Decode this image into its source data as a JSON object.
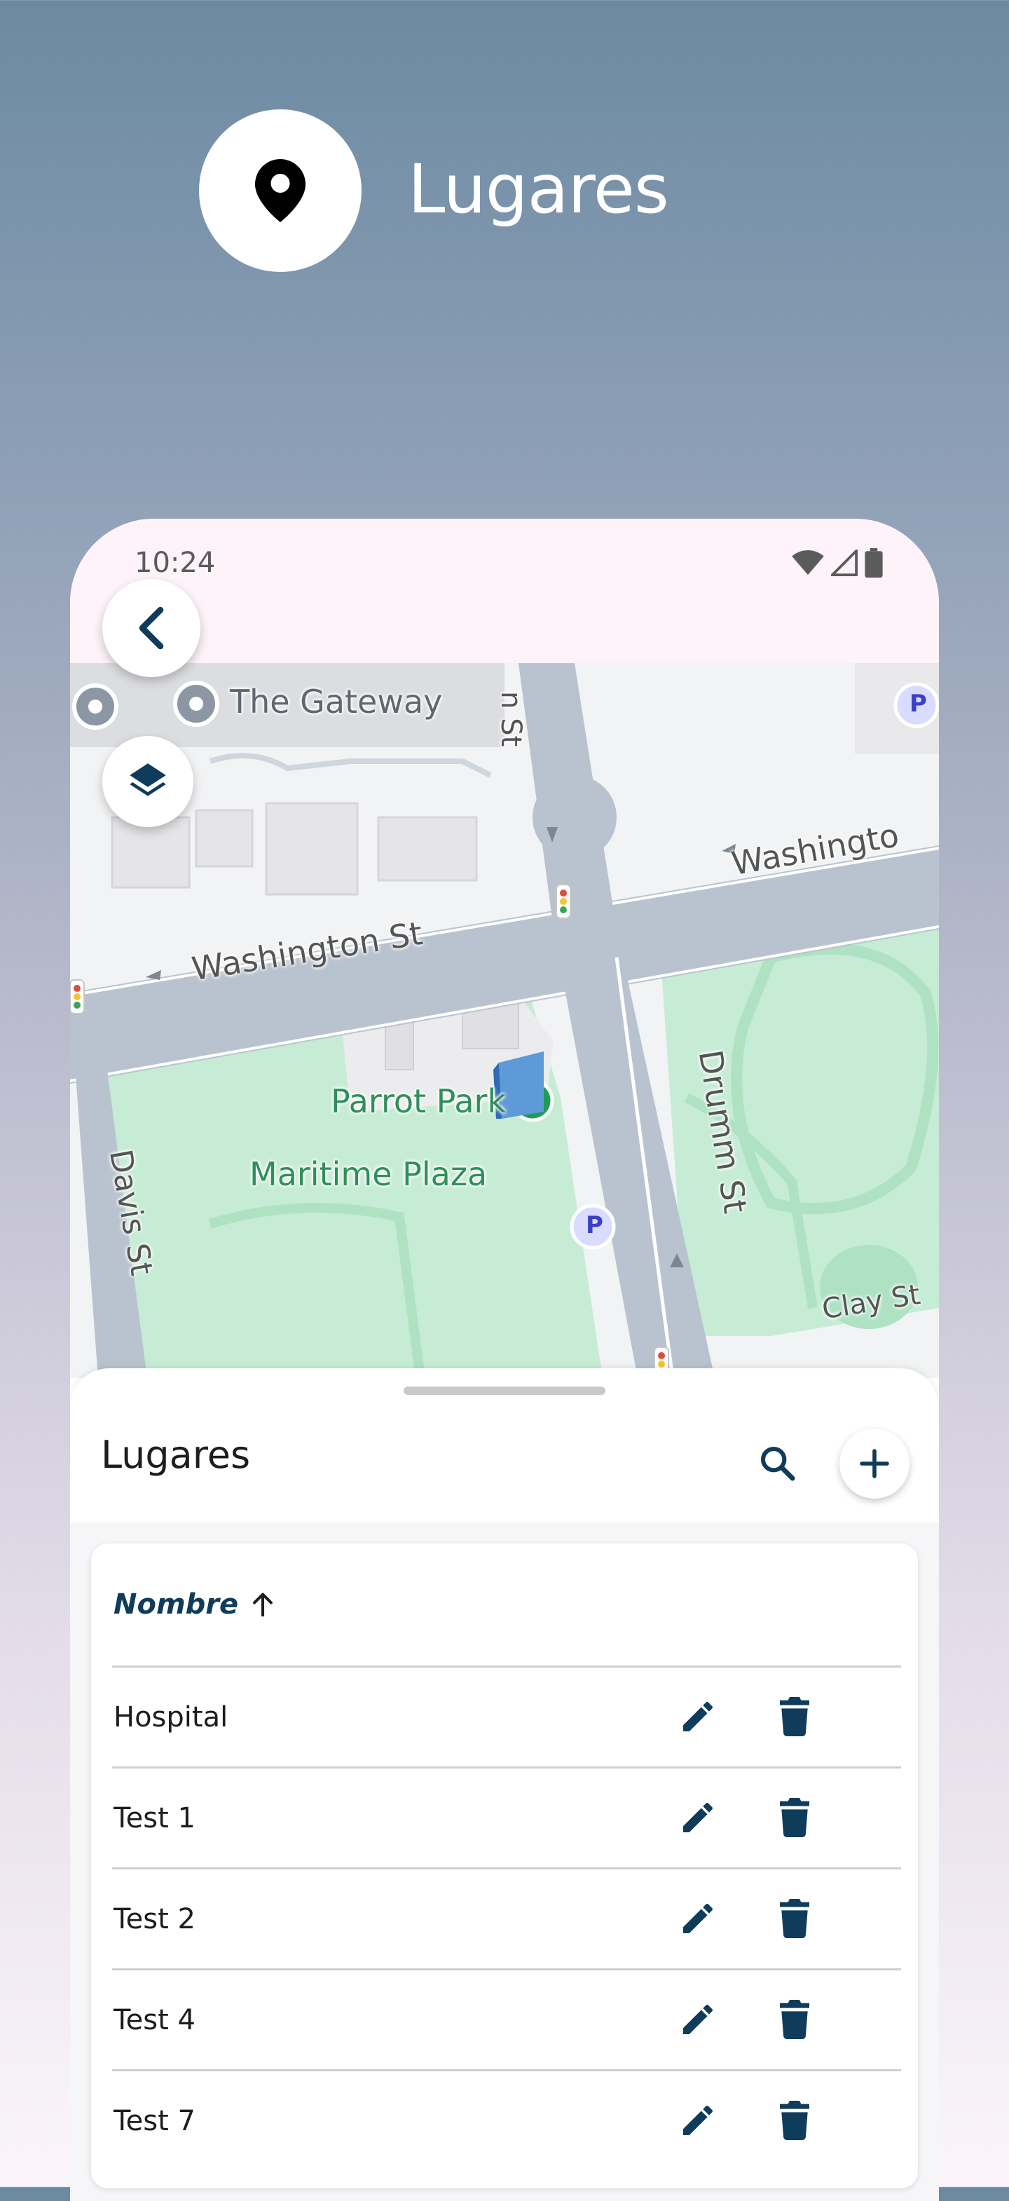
{
  "promo": {
    "title": "Lugares",
    "icon": "location-pin-icon"
  },
  "status_bar": {
    "time": "10:24",
    "icons": [
      "wifi-icon",
      "cell-signal-icon",
      "battery-icon"
    ]
  },
  "map": {
    "labels": {
      "gateway": "The Gateway",
      "washington_left": "Washington St",
      "washington_right": "Washingto",
      "drumm": "Drumm St",
      "davis": "Davis St",
      "clay": "Clay St",
      "parrot_park": "Parrot Park",
      "maritime_plaza": "Maritime Plaza",
      "top_street": "n St",
      "parking": "P"
    },
    "controls": {
      "back": "back-arrow-icon",
      "layers": "layers-icon"
    }
  },
  "sheet": {
    "title": "Lugares",
    "search_icon": "search-icon",
    "add_icon": "add-icon",
    "table": {
      "column": "Nombre",
      "sort_icon": "arrow-up-icon",
      "rows": [
        {
          "name": "Hospital"
        },
        {
          "name": "Test 1"
        },
        {
          "name": "Test 2"
        },
        {
          "name": "Test 4"
        },
        {
          "name": "Test 7"
        }
      ]
    }
  },
  "colors": {
    "accent": "#0f3c5a",
    "park": "#c6ecd5",
    "road": "#b9c3cf",
    "status_bar": "#fdf3f8"
  }
}
